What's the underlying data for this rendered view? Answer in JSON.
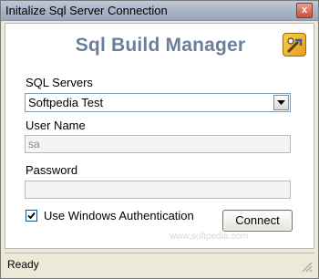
{
  "window": {
    "title": "Initalize Sql Server Connection",
    "close_glyph": "x"
  },
  "header": {
    "title": "Sql Build Manager",
    "icon": "app-tools-icon"
  },
  "form": {
    "servers_label": "SQL Servers",
    "servers_selected": "Softpedia Test",
    "username_label": "User Name",
    "username_value": "sa",
    "password_label": "Password",
    "password_value": "",
    "windows_auth_label": "Use Windows Authentication",
    "windows_auth_checked": true,
    "connect_label": "Connect"
  },
  "watermark": "www.softpedia.com",
  "status": {
    "text": "Ready"
  },
  "colors": {
    "title_text": "#6b7f9c",
    "titlebar": "#a9b4c6",
    "close_button": "#c6503a",
    "field_border": "#7f9db9"
  }
}
